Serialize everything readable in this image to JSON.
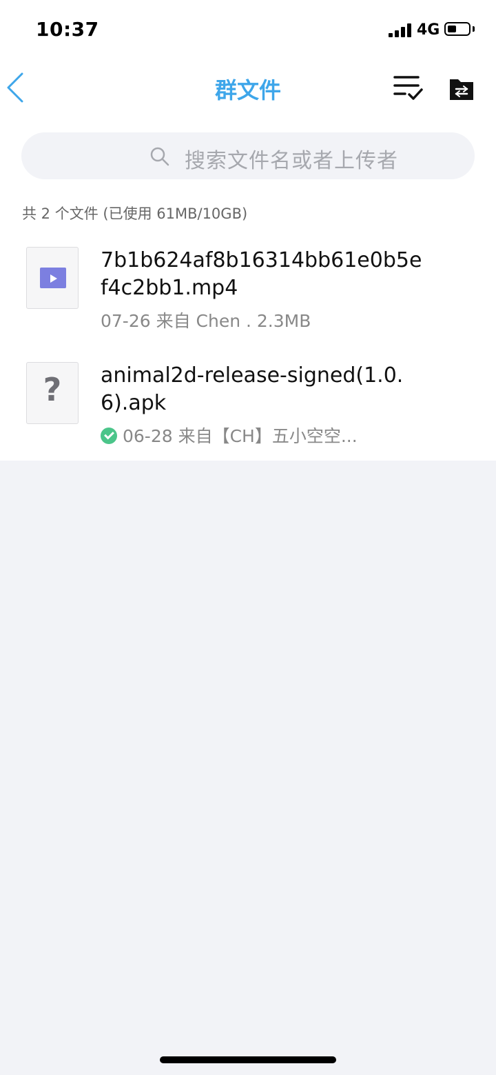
{
  "status_bar": {
    "time": "10:37",
    "network": "4G"
  },
  "nav": {
    "title": "群文件",
    "icons": [
      "back-icon",
      "sort-check-icon",
      "folder-transfer-icon"
    ]
  },
  "search": {
    "placeholder": "搜索文件名或者上传者"
  },
  "summary": {
    "file_count_text": "共 2 个文件 (已使用 61MB/10GB)"
  },
  "files": [
    {
      "name": "7b1b624af8b16314bb61e0b5ef4c2bb1.mp4",
      "meta": "07-26 来自 Chen . 2.3MB",
      "icon": "video-file-icon",
      "downloaded": false
    },
    {
      "name": "animal2d-release-signed(1.0.6).apk",
      "meta": "06-28 来自【CH】五小空空...",
      "icon": "unknown-file-icon",
      "downloaded": true
    }
  ],
  "colors": {
    "accent": "#3ea6ea",
    "video_icon": "#7c7fe0",
    "success": "#4bc58a",
    "background": "#f2f3f7"
  }
}
